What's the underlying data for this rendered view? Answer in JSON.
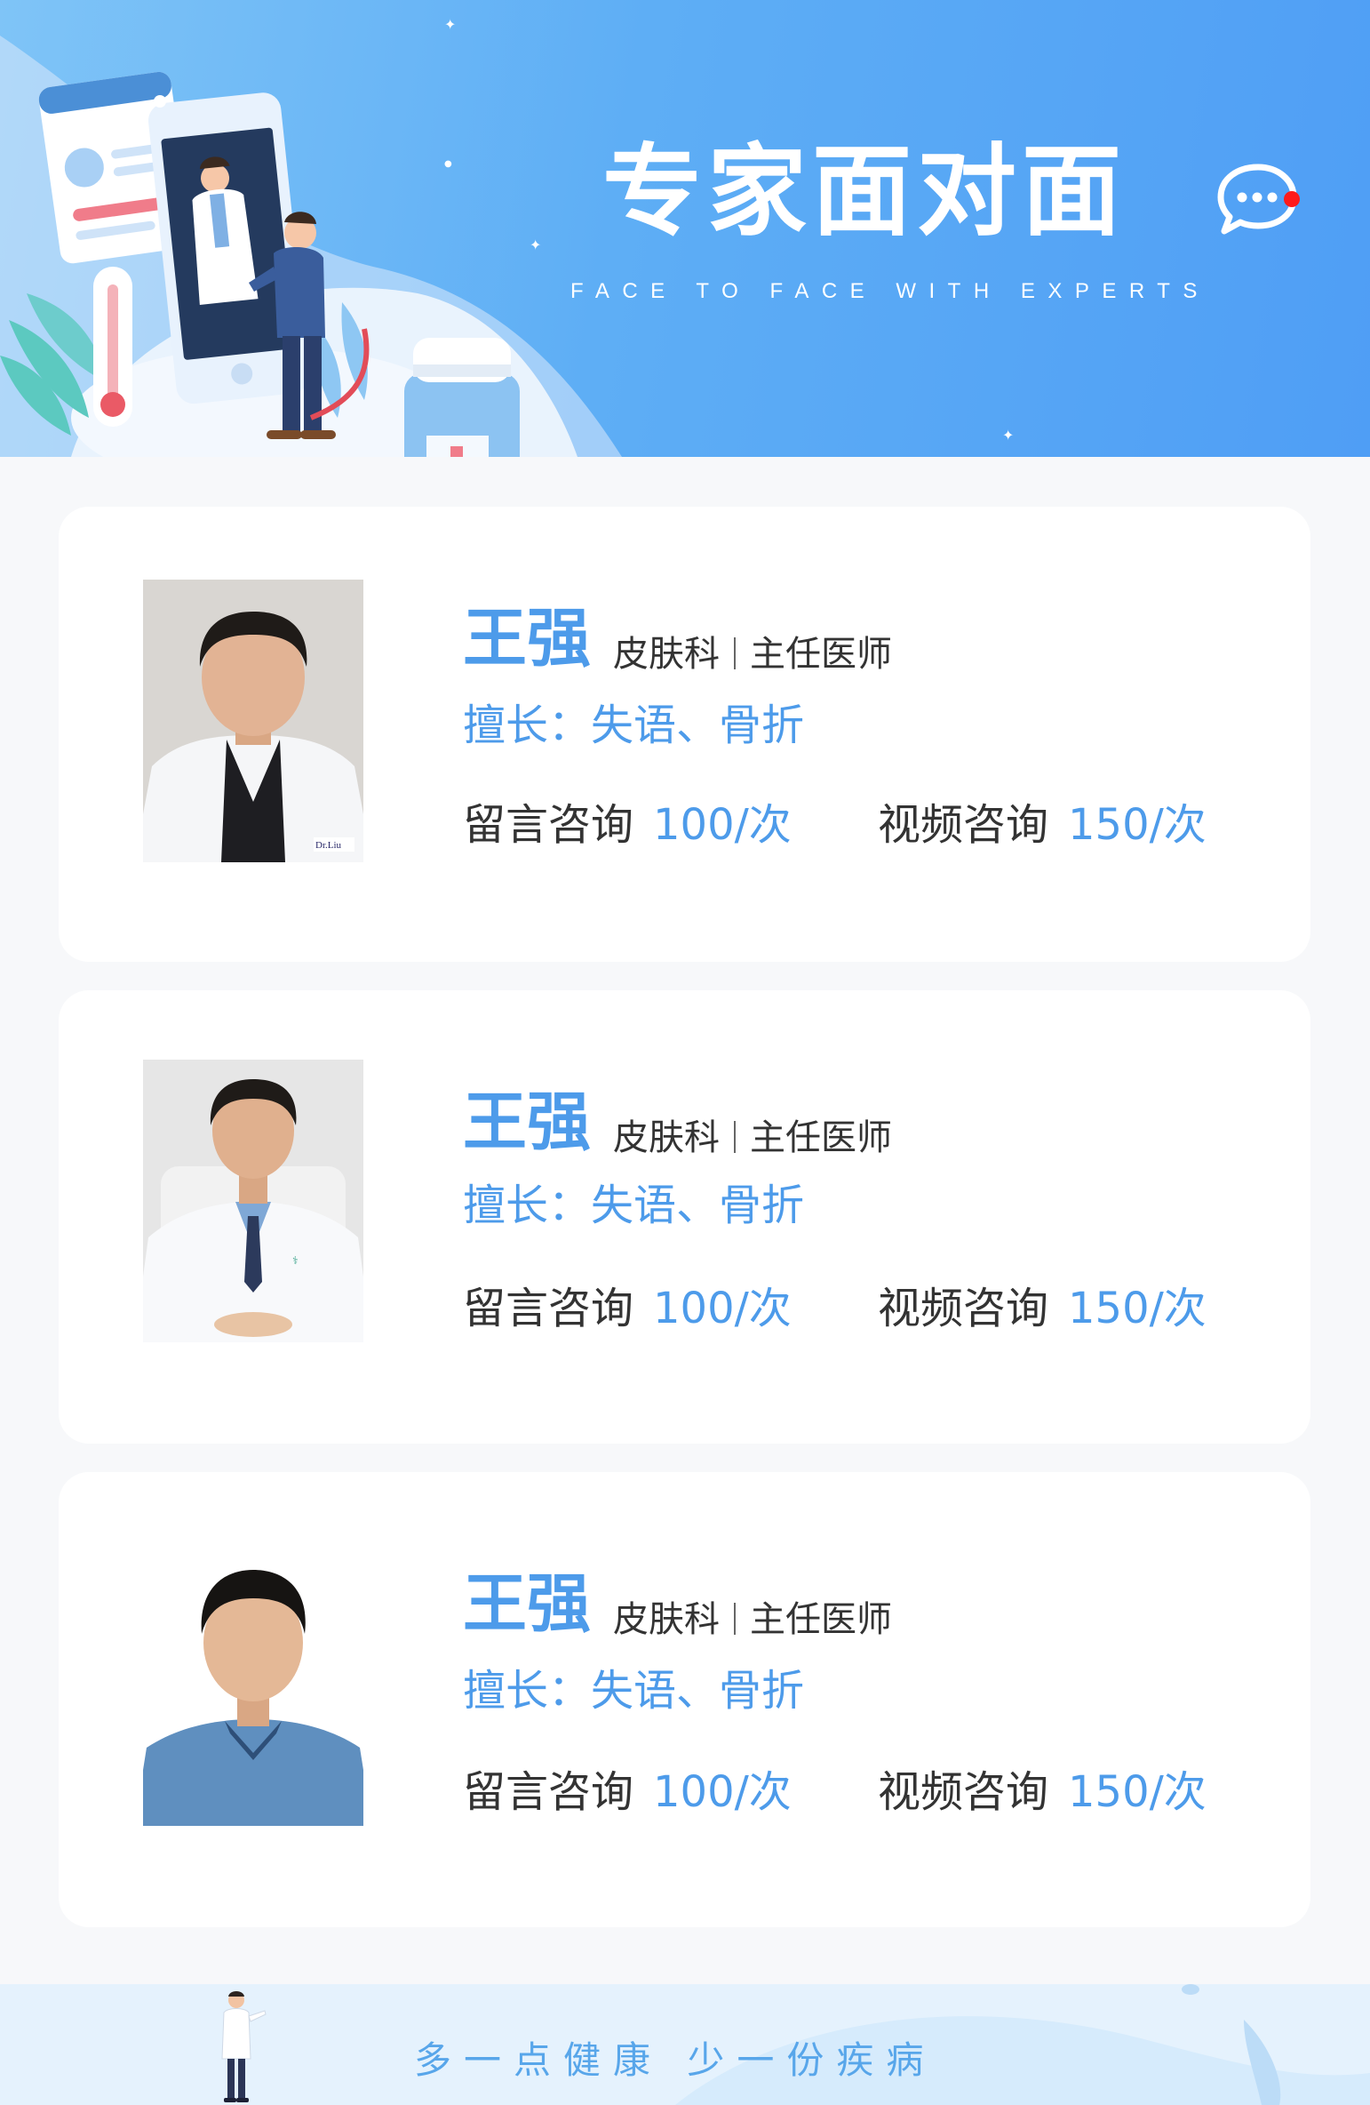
{
  "banner": {
    "title": "专家面对面",
    "subtitle": "FACE TO FACE WITH EXPERTS"
  },
  "doctors": [
    {
      "name": "王强",
      "department": "皮肤科",
      "title": "主任医师",
      "specialty": "擅长：失语、骨折",
      "message_label": "留言咨询",
      "message_price": "100/次",
      "video_label": "视频咨询",
      "video_price": "150/次",
      "photo_badge": "Dr.Liu"
    },
    {
      "name": "王强",
      "department": "皮肤科",
      "title": "主任医师",
      "specialty": "擅长：失语、骨折",
      "message_label": "留言咨询",
      "message_price": "100/次",
      "video_label": "视频咨询",
      "video_price": "150/次"
    },
    {
      "name": "王强",
      "department": "皮肤科",
      "title": "主任医师",
      "specialty": "擅长：失语、骨折",
      "message_label": "留言咨询",
      "message_price": "100/次",
      "video_label": "视频咨询",
      "video_price": "150/次"
    }
  ],
  "footer": {
    "slogan": "多一点健康 少一份疾病"
  },
  "colors": {
    "accent": "#4d9bea",
    "banner_start": "#7fc4f7",
    "banner_end": "#4f9ef5",
    "notification_dot": "#ff1a1a"
  }
}
